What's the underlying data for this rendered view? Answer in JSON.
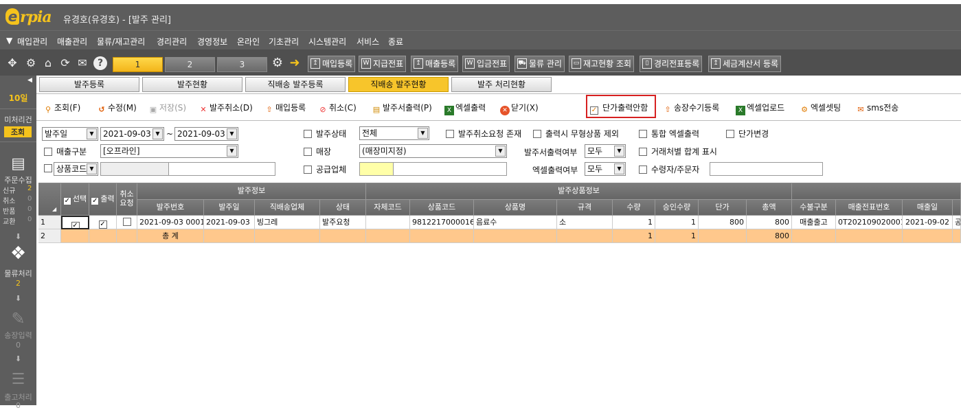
{
  "app": {
    "logo_text": "rpia",
    "logo_letter": "e",
    "window_title": "유경호(유경호) - [발주 관리]"
  },
  "menu": [
    "매입관리",
    "매출관리",
    "물류/재고관리",
    "경리관리",
    "경영정보",
    "온라인",
    "기초관리",
    "시스템관리",
    "서비스",
    "종료"
  ],
  "toolbar": {
    "page_tabs": [
      "1",
      "2",
      "3"
    ],
    "buttons": [
      "매입등록",
      "지급전표",
      "매출등록",
      "입금전표",
      "물류 관리",
      "재고현황 조회",
      "경리전표등록",
      "세금계산서 등록"
    ]
  },
  "sidebar": {
    "day": "10일",
    "pending_label": "미처리건",
    "query_button": "조회",
    "order_collect_label": "주문수집",
    "stats": [
      {
        "label": "신규",
        "value": "2"
      },
      {
        "label": "취소",
        "value": "0"
      },
      {
        "label": "반품",
        "value": "0"
      },
      {
        "label": "교환",
        "value": "0"
      }
    ],
    "logistics_label": "물류처리",
    "logistics_count": "2",
    "invoice_label": "송장입력",
    "invoice_count": "0",
    "ship_label": "출고처리",
    "ship_count": "0"
  },
  "tabs": [
    "발주등록",
    "발주현황",
    "직배송 발주등록",
    "직배송 발주현황",
    "발주 처리현황"
  ],
  "actions": {
    "query": "조회(F)",
    "edit": "수정(M)",
    "save": "저장(S)",
    "cancel_order": "발주취소(D)",
    "purchase_reg": "매입등록",
    "cancel": "취소(C)",
    "order_print": "발주서출력(P)",
    "excel_out": "엑셀출력",
    "close": "닫기(X)",
    "no_unit_price": "단가출력안함",
    "invoice_reg": "송장수기등록",
    "excel_upload": "엑셀업로드",
    "excel_setting": "엑셀셋팅",
    "sms": "sms전송"
  },
  "filters": {
    "date_type": "발주일",
    "date_from": "2021-09-03",
    "date_sep": "~",
    "date_to": "2021-09-03",
    "order_status_label": "발주상태",
    "order_status_value": "전체",
    "cancel_request_exists": "발주취소요청 존재",
    "exclude_intangible": "출력시 무형상품 제외",
    "combined_excel": "통합 엑셀출력",
    "price_change": "단가변경",
    "sales_type_label": "매출구분",
    "sales_type_value": "[오프라인]",
    "store_label": "매장",
    "store_value": "(매장미지정)",
    "order_print_label": "발주서출력여부",
    "order_print_value": "모두",
    "partner_total": "거래처별 합계 표시",
    "product_code_select": "상품코드",
    "supplier_label": "공급업체",
    "excel_print_label": "엑셀출력여부",
    "excel_print_value": "모두",
    "recipient_label": "수령자/주문자"
  },
  "grid": {
    "group_order_info": "발주정보",
    "group_product_info": "발주상품정보",
    "col_select": "선택",
    "col_print": "출력",
    "col_cancel_req": "취소요청",
    "columns": [
      "발주번호",
      "발주일",
      "직배송업체",
      "상태",
      "자체코드",
      "상품코드",
      "상품명",
      "규격",
      "수량",
      "승인수량",
      "단가",
      "총액",
      "수불구분",
      "매출전표번호",
      "매출일"
    ],
    "rows": [
      {
        "no": "1",
        "order_no": "2021-09-03  0001",
        "order_date": "2021-09-03",
        "vendor": "빙그레",
        "status": "발주요청",
        "own_code": "",
        "product_code": "9812217000016",
        "product_name": "음료수",
        "spec": "소",
        "qty": "1",
        "approved_qty": "1",
        "unit_price": "800",
        "total": "800",
        "stock_type": "매출출고",
        "slip_no": "0T202109020001",
        "sales_date": "2021-09-02",
        "extra": "공"
      }
    ],
    "total_row": {
      "no": "2",
      "label": "총      계",
      "qty": "1",
      "approved_qty": "1",
      "total": "800"
    }
  }
}
